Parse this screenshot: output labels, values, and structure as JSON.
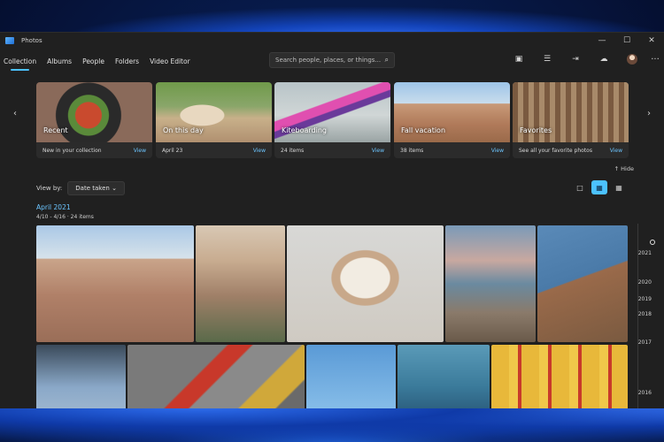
{
  "window": {
    "app_title": "Photos"
  },
  "nav": {
    "tabs": [
      {
        "label": "Collection",
        "active": true
      },
      {
        "label": "Albums"
      },
      {
        "label": "People"
      },
      {
        "label": "Folders"
      },
      {
        "label": "Video Editor"
      }
    ],
    "search_placeholder": "Search people, places, or things..."
  },
  "memories": [
    {
      "title": "Recent",
      "subtitle": "New in your collection",
      "action": "View"
    },
    {
      "title": "On this day",
      "subtitle": "April 23",
      "action": "View"
    },
    {
      "title": "Kiteboarding",
      "subtitle": "24 items",
      "action": "View"
    },
    {
      "title": "Fall vacation",
      "subtitle": "38 items",
      "action": "View"
    },
    {
      "title": "Favorites",
      "subtitle": "See all your favorite photos",
      "action": "View"
    }
  ],
  "hide_label": "Hide",
  "view_by": {
    "label": "View by:",
    "value": "Date taken"
  },
  "group": {
    "month": "April 2021",
    "range": "4/10 - 4/16 · 24 items"
  },
  "timeline_years": [
    "2021",
    "2020",
    "2019",
    "2018",
    "2017",
    "2016"
  ],
  "colors": {
    "accent": "#4cc2ff",
    "window_bg": "#202020"
  }
}
